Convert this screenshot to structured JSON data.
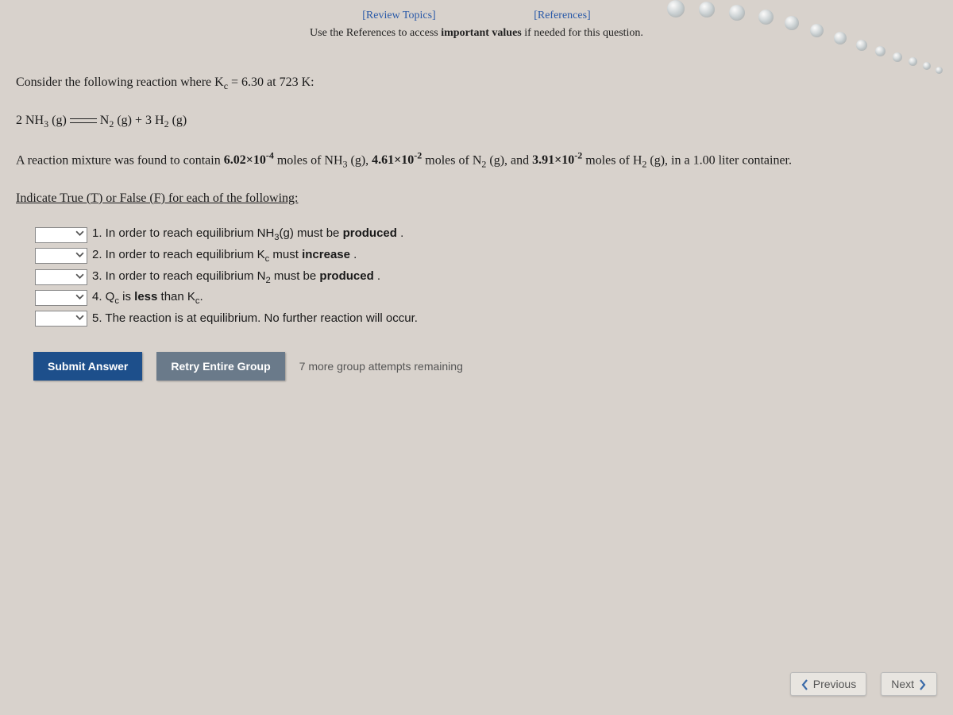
{
  "top": {
    "review": "[Review Topics]",
    "references": "[References]",
    "instruction_prefix": "Use the References to access ",
    "instruction_bold": "important values",
    "instruction_suffix": " if needed for this question."
  },
  "question": {
    "line1_prefix": "Consider the following reaction where K",
    "line1_sub": "c",
    "line1_mid": " = 6.30 at 723 K:",
    "reaction_lhs": "2 NH",
    "reaction_lhs_sub": "3",
    "reaction_lhs_state": " (g) ",
    "reaction_rhs1": " N",
    "reaction_rhs1_sub": "2",
    "reaction_rhs1_state": " (g) + 3 H",
    "reaction_rhs2_sub": "2",
    "reaction_rhs2_state": " (g)",
    "mix1": "A reaction mixture was found to contain ",
    "mix_v1": "6.02×10",
    "mix_v1_sup": "-4",
    "mix_sp1": " moles of NH",
    "mix_sp1_sub": "3",
    "mix_sp1_state": " (g), ",
    "mix_v2": "4.61×10",
    "mix_v2_sup": "-2",
    "mix_sp2": " moles of N",
    "mix_sp2_sub": "2",
    "mix_sp2_state": " (g), and ",
    "mix_v3": "3.91×10",
    "mix_v3_sup": "-2",
    "mix_sp3": " moles of H",
    "mix_sp3_sub": "2",
    "mix_sp3_state": " (g), in a 1.00 liter container.",
    "indicate": "Indicate True (T) or False (F) for each of the following:"
  },
  "statements": [
    {
      "num": "1.",
      "pre": " In order to reach equilibrium NH",
      "sub": "3",
      "mid": "(g) must be ",
      "bold": "produced",
      "post": " ."
    },
    {
      "num": "2.",
      "pre": " In order to reach equilibrium K",
      "sub": "c",
      "mid": " must ",
      "bold": "increase",
      "post": " ."
    },
    {
      "num": "3.",
      "pre": " In order to reach equilibrium N",
      "sub": "2",
      "mid": " must be ",
      "bold": "produced",
      "post": " ."
    },
    {
      "num": "4.",
      "pre": " Q",
      "sub": "c",
      "mid": " is ",
      "bold": "less",
      "post": " than K",
      "sub2": "c",
      "post2": "."
    },
    {
      "num": "5.",
      "pre": " The reaction is at equilibrium. No further reaction will occur.",
      "sub": "",
      "mid": "",
      "bold": "",
      "post": ""
    }
  ],
  "buttons": {
    "submit": "Submit Answer",
    "retry": "Retry Entire Group",
    "attempts": "7 more group attempts remaining"
  },
  "nav": {
    "previous": "Previous",
    "next": "Next"
  }
}
